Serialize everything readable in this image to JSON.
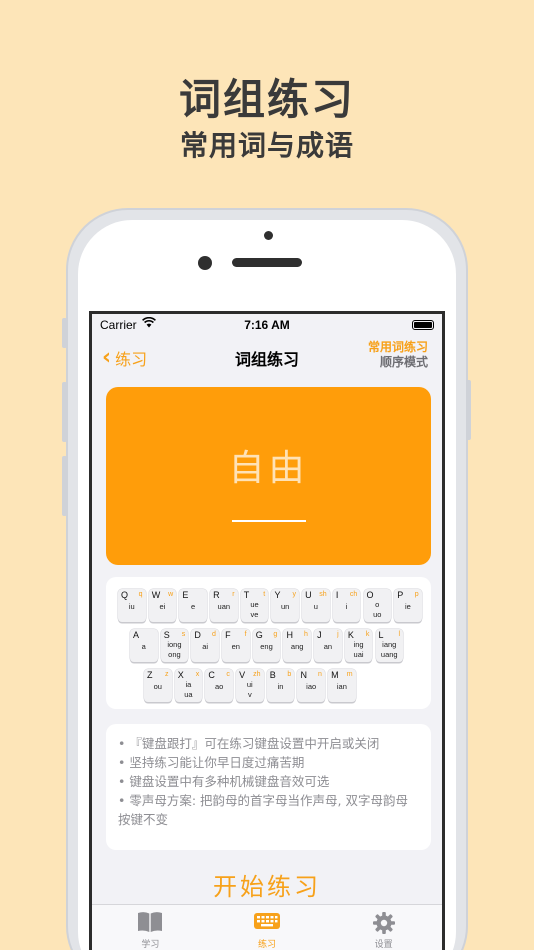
{
  "hero": {
    "title": "词组练习",
    "subtitle": "常用词与成语"
  },
  "status": {
    "carrier": "Carrier",
    "time": "7:16 AM"
  },
  "nav": {
    "back_label": "练习",
    "title": "词组练习",
    "mode_line1": "常用词练习",
    "mode_line2": "顺序模式"
  },
  "card": {
    "word": "自由"
  },
  "keyboard": {
    "rows": [
      [
        {
          "letter": "Q",
          "sub": "q",
          "fin": [
            "iu"
          ]
        },
        {
          "letter": "W",
          "sub": "w",
          "fin": [
            "ei"
          ]
        },
        {
          "letter": "E",
          "sub": "",
          "fin": [
            "e"
          ]
        },
        {
          "letter": "R",
          "sub": "r",
          "fin": [
            "uan"
          ]
        },
        {
          "letter": "T",
          "sub": "t",
          "fin": [
            "ue",
            "ve"
          ]
        },
        {
          "letter": "Y",
          "sub": "y",
          "fin": [
            "un"
          ]
        },
        {
          "letter": "U",
          "sub": "sh",
          "fin": [
            "u"
          ]
        },
        {
          "letter": "I",
          "sub": "ch",
          "fin": [
            "i"
          ]
        },
        {
          "letter": "O",
          "sub": "",
          "fin": [
            "o",
            "uo"
          ]
        },
        {
          "letter": "P",
          "sub": "p",
          "fin": [
            "ie"
          ]
        }
      ],
      [
        {
          "letter": "A",
          "sub": "",
          "fin": [
            "a"
          ]
        },
        {
          "letter": "S",
          "sub": "s",
          "fin": [
            "iong",
            "ong"
          ]
        },
        {
          "letter": "D",
          "sub": "d",
          "fin": [
            "ai"
          ]
        },
        {
          "letter": "F",
          "sub": "f",
          "fin": [
            "en"
          ]
        },
        {
          "letter": "G",
          "sub": "g",
          "fin": [
            "eng"
          ]
        },
        {
          "letter": "H",
          "sub": "h",
          "fin": [
            "ang"
          ]
        },
        {
          "letter": "J",
          "sub": "j",
          "fin": [
            "an"
          ]
        },
        {
          "letter": "K",
          "sub": "k",
          "fin": [
            "ing",
            "uai"
          ]
        },
        {
          "letter": "L",
          "sub": "l",
          "fin": [
            "iang",
            "uang"
          ]
        }
      ],
      [
        {
          "letter": "Z",
          "sub": "z",
          "fin": [
            "ou"
          ]
        },
        {
          "letter": "X",
          "sub": "x",
          "fin": [
            "ia",
            "ua"
          ]
        },
        {
          "letter": "C",
          "sub": "c",
          "fin": [
            "ao"
          ]
        },
        {
          "letter": "V",
          "sub": "zh",
          "fin": [
            "ui",
            "v"
          ]
        },
        {
          "letter": "B",
          "sub": "b",
          "fin": [
            "in"
          ]
        },
        {
          "letter": "N",
          "sub": "n",
          "fin": [
            "iao"
          ]
        },
        {
          "letter": "M",
          "sub": "m",
          "fin": [
            "ian"
          ]
        }
      ]
    ]
  },
  "tips": [
    "• 『键盘跟打』可在练习键盘设置中开启或关闭",
    "• 坚持练习能让你早日度过痛苦期",
    "• 键盘设置中有多种机械键盘音效可选",
    "• 零声母方案: 把韵母的首字母当作声母, 双字母韵母按键不变"
  ],
  "start_label": "开始练习",
  "tabs": [
    {
      "label": "学习",
      "icon": "book-icon"
    },
    {
      "label": "练习",
      "icon": "keyboard-icon"
    },
    {
      "label": "设置",
      "icon": "gear-icon"
    }
  ],
  "colors": {
    "accent": "#f7a11a",
    "card": "#ff9d0a",
    "background": "#fde5b8"
  }
}
